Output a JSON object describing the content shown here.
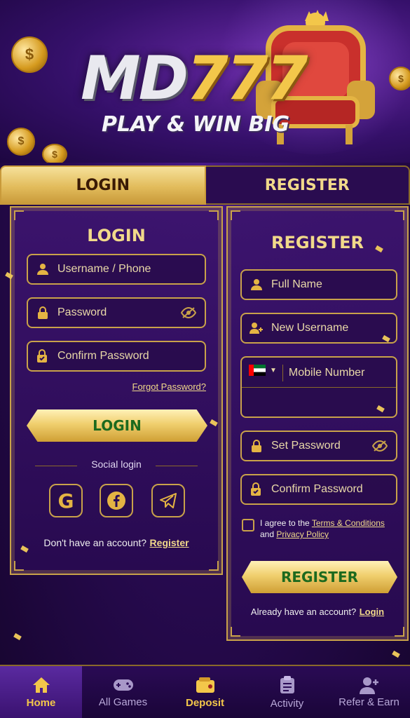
{
  "hero": {
    "logo_white": "MD",
    "logo_gold": "777",
    "tagline": "PLAY & WIN BIG"
  },
  "tabs": [
    {
      "label": "LOGIN",
      "active": true
    },
    {
      "label": "REGISTER",
      "active": false
    }
  ],
  "login": {
    "title": "LOGIN",
    "username_placeholder": "Username / Phone",
    "password_placeholder": "Password",
    "confirm_password_placeholder": "Confirm Password",
    "forgot_password": "Forgot Password?",
    "login_button": "LOGIN",
    "social_label": "Social login",
    "no_account_text": "Don't have an account?",
    "register_link": "Register"
  },
  "register": {
    "title": "REGISTER",
    "full_name_placeholder": "Full Name",
    "new_username_placeholder": "New Username",
    "mobile_placeholder": "Mobile Number",
    "set_password_placeholder": "Set Password",
    "confirm_password_placeholder": "Confirm Password",
    "agree_text": "I agree to the",
    "terms_link": "Terms & Conditions",
    "and_text": "and",
    "privacy_link": "Privacy Policy",
    "register_button": "REGISTER",
    "have_account_text": "Already have an account?",
    "login_link": "Login"
  },
  "nav": [
    {
      "label": "Home",
      "icon": "home-icon",
      "active": true
    },
    {
      "label": "All Games",
      "icon": "gamepad-icon",
      "active": false
    },
    {
      "label": "Deposit",
      "icon": "wallet-icon",
      "active": false
    },
    {
      "label": "Activity",
      "icon": "clipboard-icon",
      "active": false
    },
    {
      "label": "Refer & Earn",
      "icon": "add-user-icon",
      "active": false
    }
  ],
  "colors": {
    "gold": "#f1d98a",
    "purple_dark": "#2a0b55",
    "button_text_green": "#1d6a1e"
  }
}
